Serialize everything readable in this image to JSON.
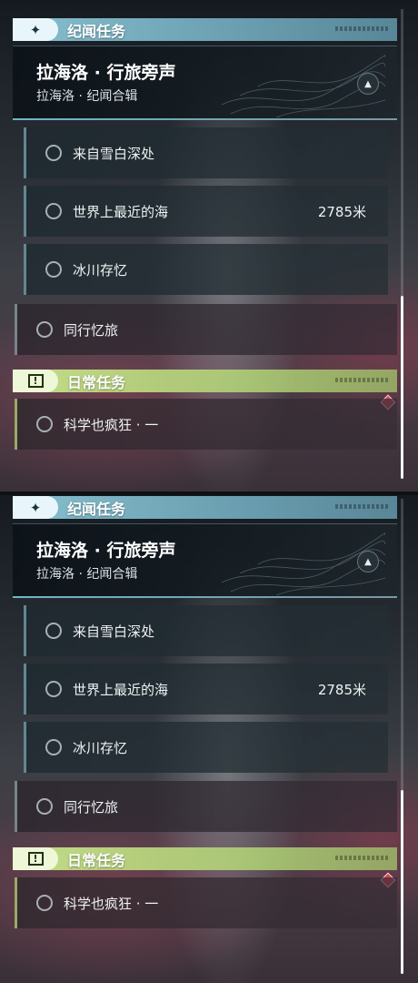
{
  "panels": [
    {
      "story_header": {
        "icon": "sparkle-icon",
        "title": "纪闻任务"
      },
      "quest": {
        "title": "拉海洛 · 行旅旁声",
        "subtitle": "拉海洛 · 纪闻合辑",
        "toggle_icon": "collapse-up-icon"
      },
      "sub_quests": [
        {
          "label": "来自雪白深处",
          "distance": ""
        },
        {
          "label": "世界上最近的海",
          "distance": "2785米"
        },
        {
          "label": "冰川存忆",
          "distance": ""
        }
      ],
      "standalone": {
        "label": "同行忆旅"
      },
      "daily_header": {
        "icon": "exclamation-box-icon",
        "icon_text": "!",
        "title": "日常任务"
      },
      "daily_quests": [
        {
          "label": "科学也疯狂 · 一"
        }
      ]
    },
    {
      "story_header": {
        "icon": "sparkle-icon",
        "title": "纪闻任务"
      },
      "quest": {
        "title": "拉海洛 · 行旅旁声",
        "subtitle": "拉海洛 · 纪闻合辑",
        "toggle_icon": "collapse-up-icon"
      },
      "sub_quests": [
        {
          "label": "来自雪白深处",
          "distance": ""
        },
        {
          "label": "世界上最近的海",
          "distance": "2785米"
        },
        {
          "label": "冰川存忆",
          "distance": ""
        }
      ],
      "standalone": {
        "label": "同行忆旅"
      },
      "daily_header": {
        "icon": "exclamation-box-icon",
        "icon_text": "!",
        "title": "日常任务"
      },
      "daily_quests": [
        {
          "label": "科学也疯狂 · 一"
        }
      ]
    }
  ],
  "colors": {
    "story_accent": "#8cc8d7",
    "daily_accent": "#c8e68c",
    "marker_red": "#d8455a"
  }
}
